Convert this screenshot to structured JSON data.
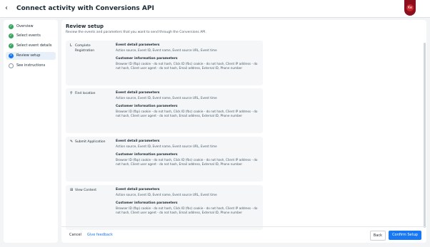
{
  "header": {
    "back_glyph": "‹",
    "title": "Connect activity with Conversions API",
    "avatar_initials": "Ke",
    "badge_color": "#8b0f1c"
  },
  "sidebar": {
    "steps": [
      {
        "label": "Overview",
        "state": "done",
        "glyph": "✓"
      },
      {
        "label": "Select events",
        "state": "done",
        "glyph": "✓"
      },
      {
        "label": "Select event details",
        "state": "done",
        "glyph": "✓"
      },
      {
        "label": "Review setup",
        "state": "current",
        "glyph": "•"
      },
      {
        "label": "See instructions",
        "state": "pending",
        "glyph": ""
      }
    ]
  },
  "main": {
    "title": "Review setup",
    "subtitle": "Review the events and parameters that you want to send through the Conversions API.",
    "events": [
      {
        "icon": "L",
        "name": "Complete Registration",
        "details_title": "Event detail parameters",
        "details_text": "Action source, Event ID, Event name, Event source URL, Event time",
        "customer_title": "Customer information parameters",
        "customer_text": "Browser ID (fbp) cookie - do not hash, Click ID (fbc) cookie - do not hash, Client IP address - do not hash, Client user agent - do not hash, Email address, External ID, Phone number"
      },
      {
        "icon": "⚲",
        "name": "Find location",
        "details_title": "Event detail parameters",
        "details_text": "Action source, Event ID, Event name, Event source URL, Event time",
        "customer_title": "Customer information parameters",
        "customer_text": "Browser ID (fbp) cookie - do not hash, Click ID (fbc) cookie - do not hash, Client IP address - do not hash, Client user agent - do not hash, Email address, External ID, Phone number"
      },
      {
        "icon": "✎",
        "name": "Submit Application",
        "details_title": "Event detail parameters",
        "details_text": "Action source, Event ID, Event name, Event source URL, Event time",
        "customer_title": "Customer information parameters",
        "customer_text": "Browser ID (fbp) cookie - do not hash, Click ID (fbc) cookie - do not hash, Client IP address - do not hash, Client user agent - do not hash, Email address, External ID, Phone number"
      },
      {
        "icon": "⊞",
        "name": "View Content",
        "details_title": "Event detail parameters",
        "details_text": "Action source, Event ID, Event name, Event source URL, Event time",
        "customer_title": "Customer information parameters",
        "customer_text": "Browser ID (fbp) cookie - do not hash, Click ID (fbc) cookie - do not hash, Client IP address - do not hash, Client user agent - do not hash, Email address, External ID, Phone number"
      }
    ]
  },
  "footer": {
    "cancel_label": "Cancel",
    "feedback_label": "Give feedback",
    "back_label": "Back",
    "confirm_label": "Confirm Setup",
    "accent_color": "#1877f2"
  }
}
